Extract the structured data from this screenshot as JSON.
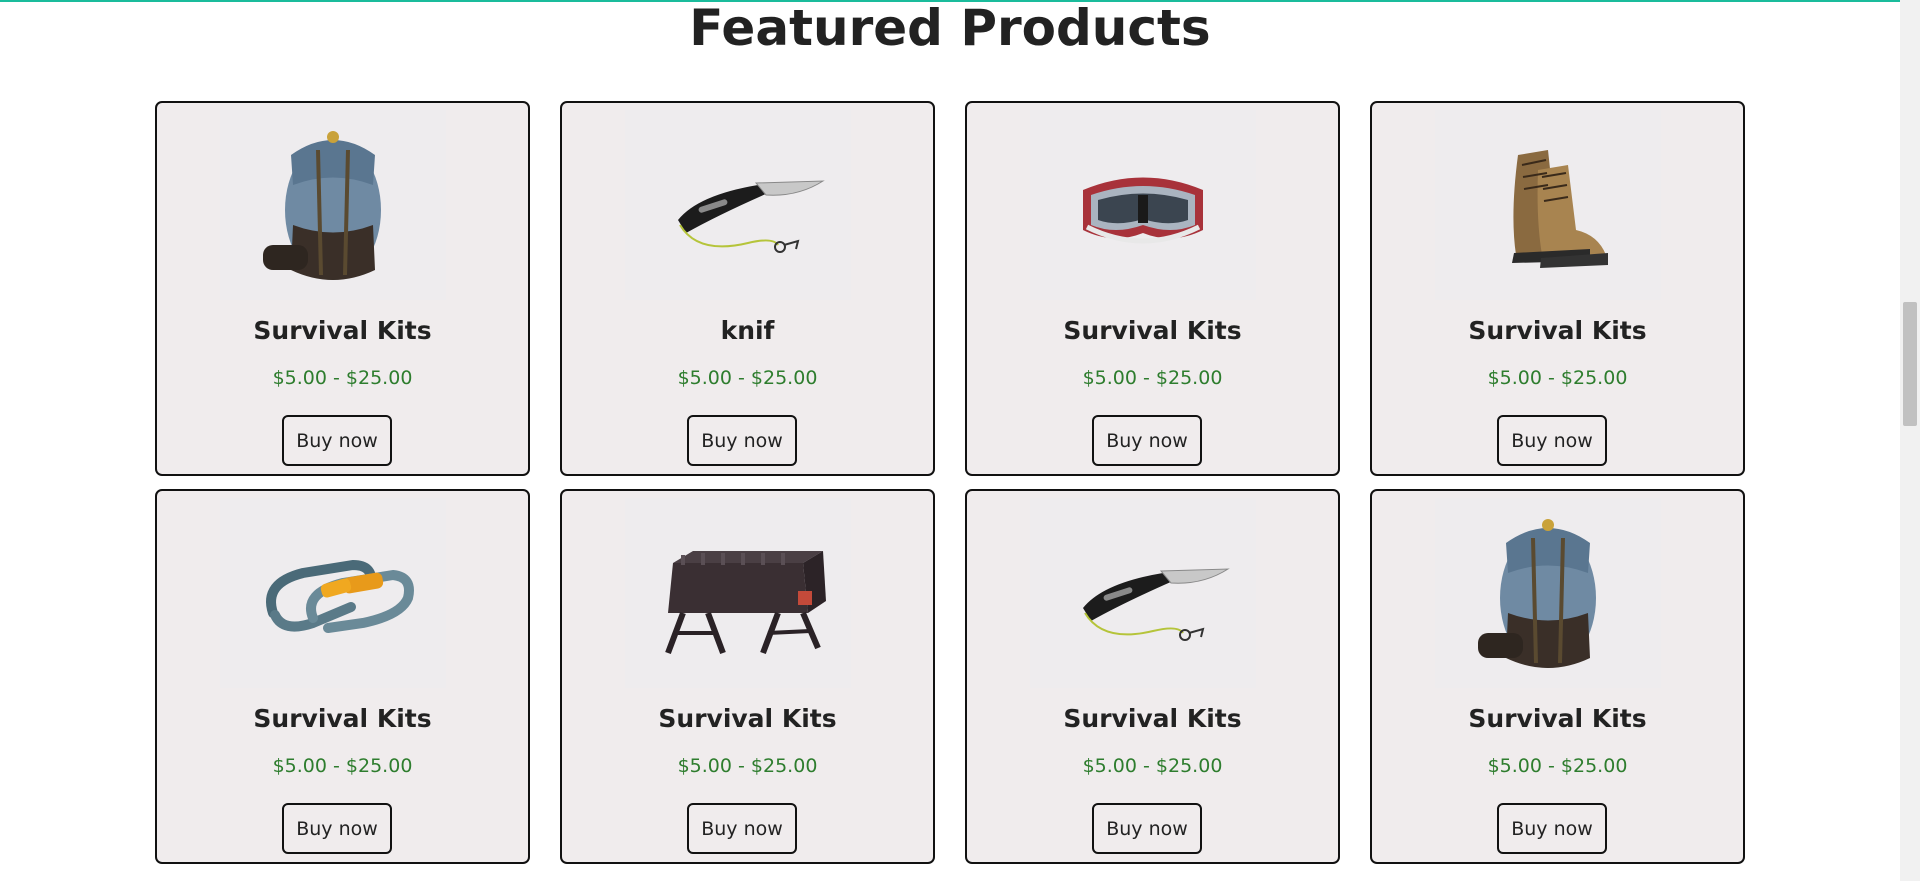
{
  "section": {
    "title": "Featured Products"
  },
  "products": [
    {
      "name": "Survival Kits",
      "price": "$5.00 - $25.00",
      "button": "Buy now",
      "image": "backpack-icon"
    },
    {
      "name": "knif",
      "price": "$5.00 - $25.00",
      "button": "Buy now",
      "image": "knife-icon"
    },
    {
      "name": "Survival Kits",
      "price": "$5.00 - $25.00",
      "button": "Buy now",
      "image": "goggles-icon"
    },
    {
      "name": "Survival Kits",
      "price": "$5.00 - $25.00",
      "button": "Buy now",
      "image": "hiking-boot-icon"
    },
    {
      "name": "Survival Kits",
      "price": "$5.00 - $25.00",
      "button": "Buy now",
      "image": "carabiner-icon"
    },
    {
      "name": "Survival Kits",
      "price": "$5.00 - $25.00",
      "button": "Buy now",
      "image": "grill-icon"
    },
    {
      "name": "Survival Kits",
      "price": "$5.00 - $25.00",
      "button": "Buy now",
      "image": "knife-icon"
    },
    {
      "name": "Survival Kits",
      "price": "$5.00 - $25.00",
      "button": "Buy now",
      "image": "backpack-icon"
    }
  ],
  "colors": {
    "accent": "#1abc9c",
    "price": "#2e7d2e",
    "card_background": "#f0eced",
    "border": "#111111"
  }
}
